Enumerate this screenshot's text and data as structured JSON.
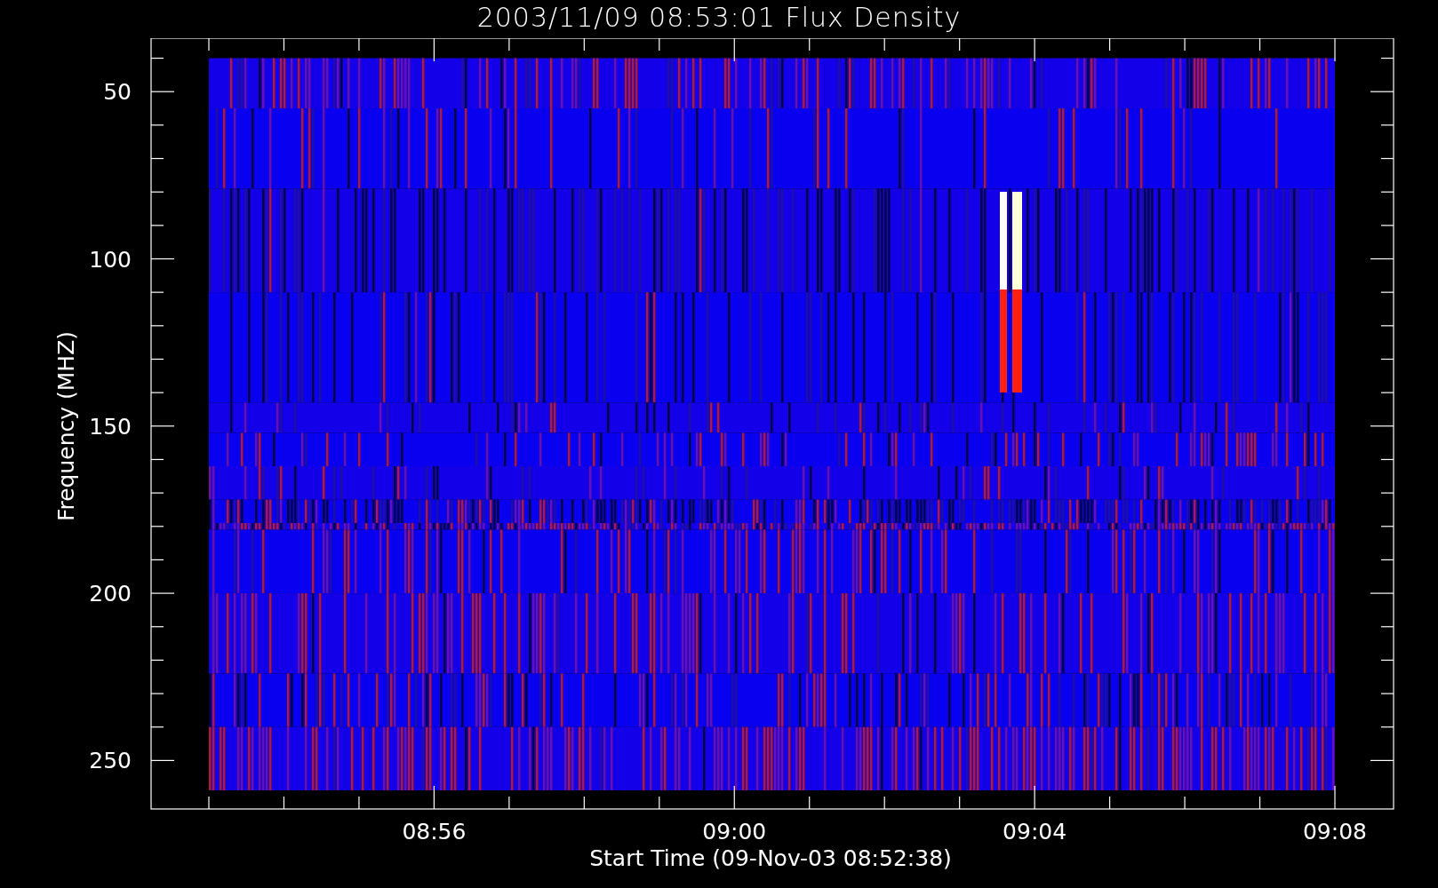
{
  "title": "2003/11/09 08:53:01 Flux Density",
  "plot": {
    "ylabel": "Frequency (MHZ)",
    "xlabel": "Start Time (09-Nov-03 08:52:38)",
    "yticks": [
      "50",
      "100",
      "150",
      "200",
      "250"
    ],
    "xticks": [
      "08:56",
      "09:00",
      "09:04",
      "09:08"
    ]
  }
}
